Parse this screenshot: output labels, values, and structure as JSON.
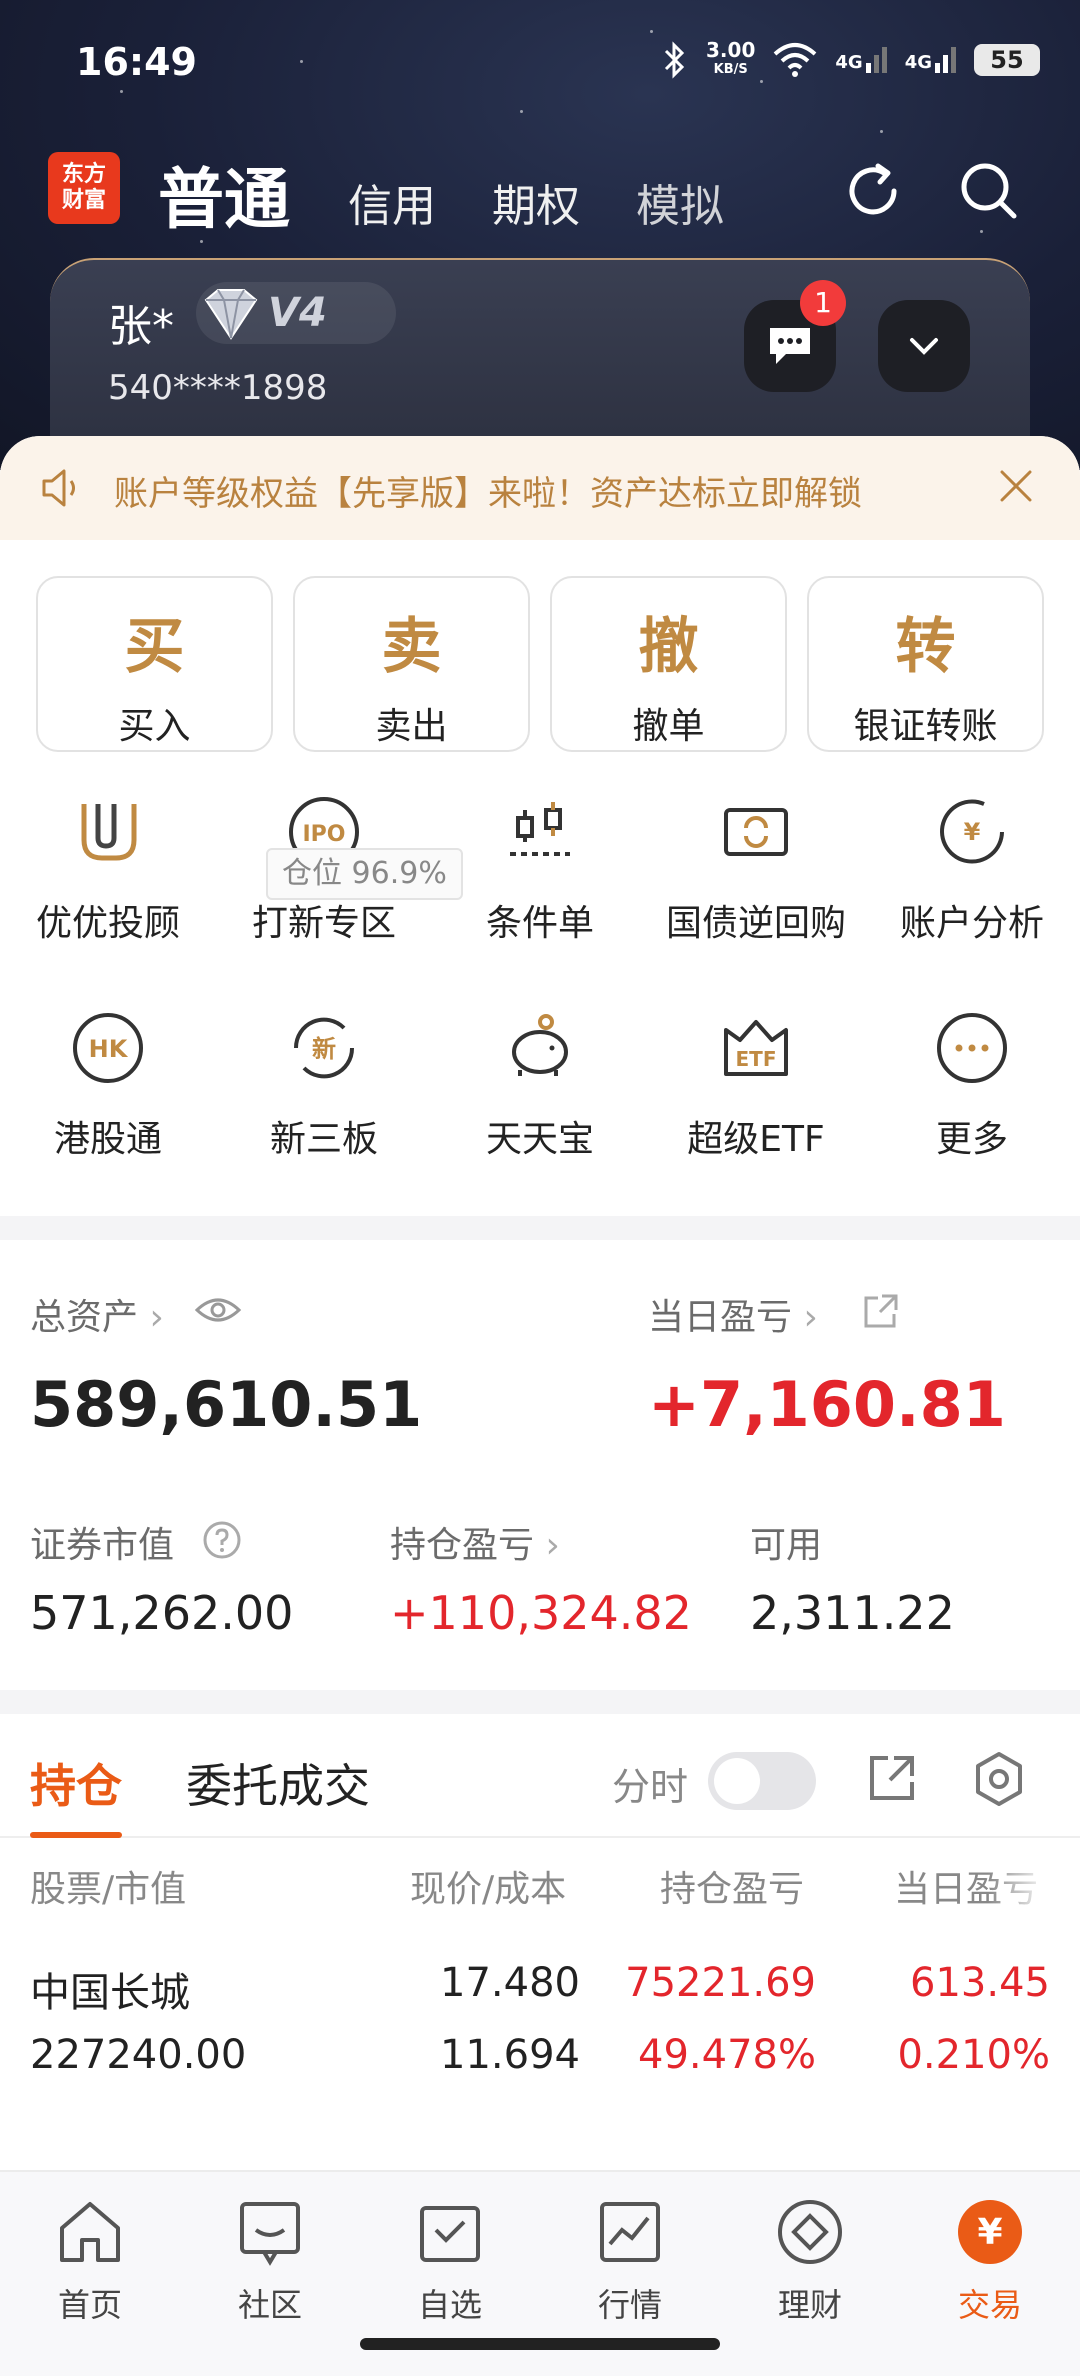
{
  "status_bar": {
    "time": "16:49",
    "speed_value": "3.00",
    "speed_unit": "KB/S",
    "net1": "4G",
    "net2": "4G",
    "battery": "55"
  },
  "header": {
    "logo_line1": "东方",
    "logo_line2": "财富",
    "tabs": [
      "普通",
      "信用",
      "期权",
      "模拟"
    ],
    "user_name": "张*",
    "vip_level": "V4",
    "account_number": "540****1898",
    "message_badge": "1"
  },
  "notice": {
    "text": "账户等级权益【先享版】来啦！资产达标立即解锁"
  },
  "trade_buttons": [
    {
      "big": "买",
      "label": "买入"
    },
    {
      "big": "卖",
      "label": "卖出"
    },
    {
      "big": "撤",
      "label": "撤单"
    },
    {
      "big": "转",
      "label": "银证转账"
    }
  ],
  "features_row1": [
    "优优投顾",
    "打新专区",
    "条件单",
    "国债逆回购",
    "账户分析"
  ],
  "features_row2": [
    "港股通",
    "新三板",
    "天天宝",
    "超级ETF",
    "更多"
  ],
  "feature_icon_text": {
    "ipo": "IPO",
    "yen": "¥",
    "hk": "HK",
    "new": "新",
    "etf": "ETF"
  },
  "assets": {
    "total_label": "总资产",
    "position_label": "仓位",
    "position_value": "96.9%",
    "total_value": "589,610.51",
    "daily_pl_label": "当日盈亏",
    "daily_pl_value": "+7,160.81",
    "market_value_label": "证券市值",
    "market_value": "571,262.00",
    "holding_pl_label": "持仓盈亏",
    "holding_pl_value": "+110,324.82",
    "available_label": "可用",
    "available_value": "2,311.22"
  },
  "holdings": {
    "tab_active": "持仓",
    "tab_other": "委托成交",
    "timeshare_label": "分时",
    "columns": [
      "股票/市值",
      "现价/成本",
      "持仓盈亏",
      "当日盈亏"
    ],
    "rows": [
      {
        "name": "中国长城",
        "market_value": "227240.00",
        "price": "17.480",
        "cost": "11.694",
        "holding_pl": "75221.69",
        "holding_pl_pct": "49.478%",
        "daily_pl": "613.45",
        "daily_pl_pct": "0.210%"
      }
    ]
  },
  "bottom_nav": [
    "首页",
    "社区",
    "自选",
    "行情",
    "理财",
    "交易"
  ],
  "colors": {
    "accent": "#ea5b16",
    "gain": "#e3262c",
    "gold": "#c08a42"
  }
}
